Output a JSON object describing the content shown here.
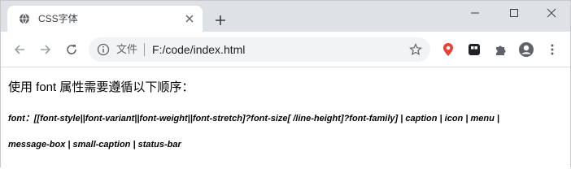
{
  "browser": {
    "tab": {
      "title": "CSS字体",
      "favicon": "globe-icon"
    },
    "address": {
      "scheme_label": "文件",
      "url": "F:/code/index.html"
    },
    "icons": {
      "close_tab": "close-icon",
      "new_tab": "plus-icon",
      "minimize": "minimize-icon",
      "maximize": "maximize-icon",
      "close_window": "close-icon",
      "back": "back-arrow-icon",
      "forward": "forward-arrow-icon",
      "reload": "reload-icon",
      "info": "info-icon",
      "bookmark": "star-icon",
      "ext1": "location-pin-icon",
      "ext2": "tab-grid-icon",
      "ext3": "puzzle-icon",
      "profile": "avatar-icon",
      "menu": "kebab-menu-icon"
    },
    "colors": {
      "tabstrip_bg": "#dee1e6",
      "omnibox_bg": "#f1f3f4",
      "ext1_accent": "#e94235"
    }
  },
  "page": {
    "heading": "使用 font 属性需要遵循以下顺序：",
    "syntax_line1": "font：[[font-style||font-variant||font-weight||font-stretch]?font-size[ /line-height]?font-family] | caption | icon | menu |",
    "syntax_line2": "message-box | small-caption | status-bar"
  }
}
